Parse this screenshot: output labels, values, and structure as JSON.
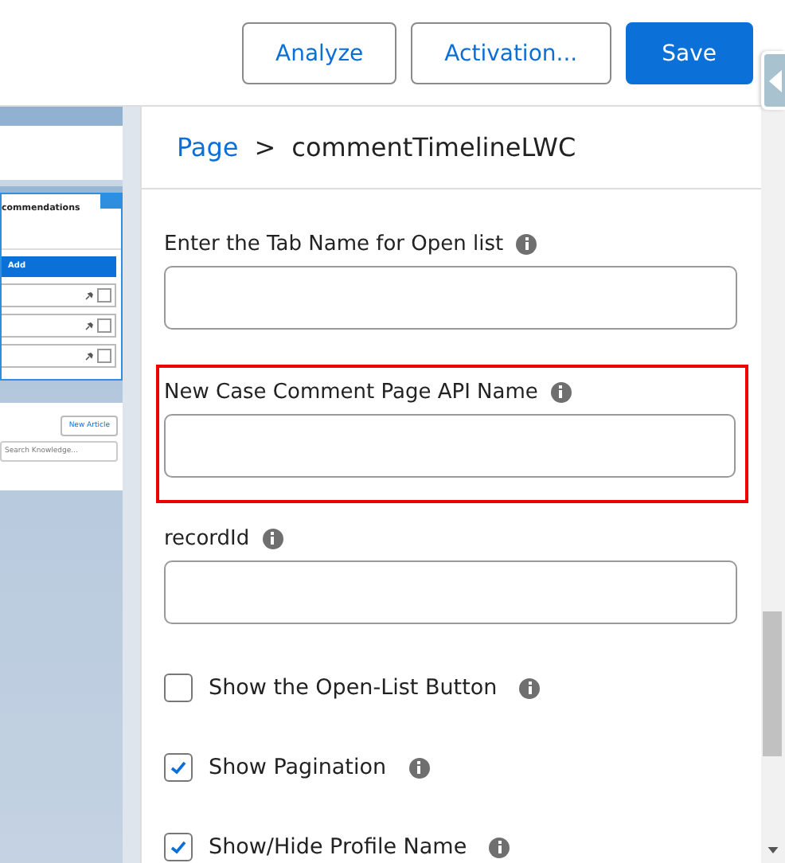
{
  "header": {
    "buttons": [
      {
        "label": "Analyze",
        "kind": "outline"
      },
      {
        "label": "Activation...",
        "kind": "outline"
      },
      {
        "label": "Save",
        "kind": "primary"
      }
    ]
  },
  "canvas_preview": {
    "component_title": "commendations",
    "add_label": "Add",
    "new_article": "New Article",
    "search_placeholder": "Search Knowledge..."
  },
  "breadcrumb": {
    "parent": "Page",
    "separator": ">",
    "current": "commentTimelineLWC"
  },
  "properties": [
    {
      "kind": "text",
      "label": "Enter the Tab Name for Open list",
      "highlighted": false
    },
    {
      "kind": "text",
      "label": "New Case Comment Page API Name",
      "highlighted": true
    },
    {
      "kind": "text",
      "label": "recordId",
      "highlighted": false
    },
    {
      "kind": "checkbox",
      "label": "Show the Open-List Button",
      "checked": false
    },
    {
      "kind": "checkbox",
      "label": "Show Pagination",
      "checked": true
    },
    {
      "kind": "checkbox",
      "label": "Show/Hide Profile Name",
      "checked": true
    }
  ]
}
